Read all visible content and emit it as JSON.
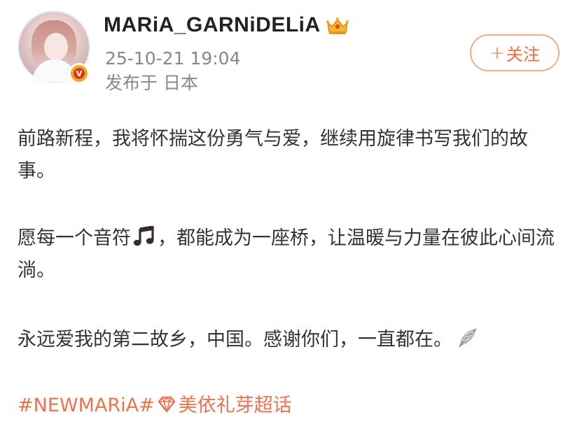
{
  "post": {
    "username": "MARiA_GARNiDELiA",
    "timestamp": "25-10-21 19:04",
    "location": "发布于 日本",
    "follow_button": {
      "plus": "+",
      "label": "关注"
    },
    "icons": {
      "badge": "crown-icon",
      "verified": "verified-badge-icon",
      "note": "musical-note-icon",
      "feather": "feather-icon",
      "diamond": "diamond-icon"
    },
    "colors": {
      "accent": "#eb7350",
      "follow": "#f26a3c",
      "meta_text": "#888888",
      "body_text": "#333333"
    },
    "content": {
      "p1": "前路新程，我将怀揣这份勇气与爱，继续用旋律书写我们的故事。",
      "p2_before": "愿每一个音符",
      "p2_after": "，都能成为一座桥，让温暖与力量在彼此心间流淌。",
      "p3": "永远爱我的第二故乡，中国。感谢你们，一直都在。"
    },
    "hashtags": {
      "tag1": "#NEWMARiA#",
      "tag2": "美依礼芽超话"
    }
  }
}
